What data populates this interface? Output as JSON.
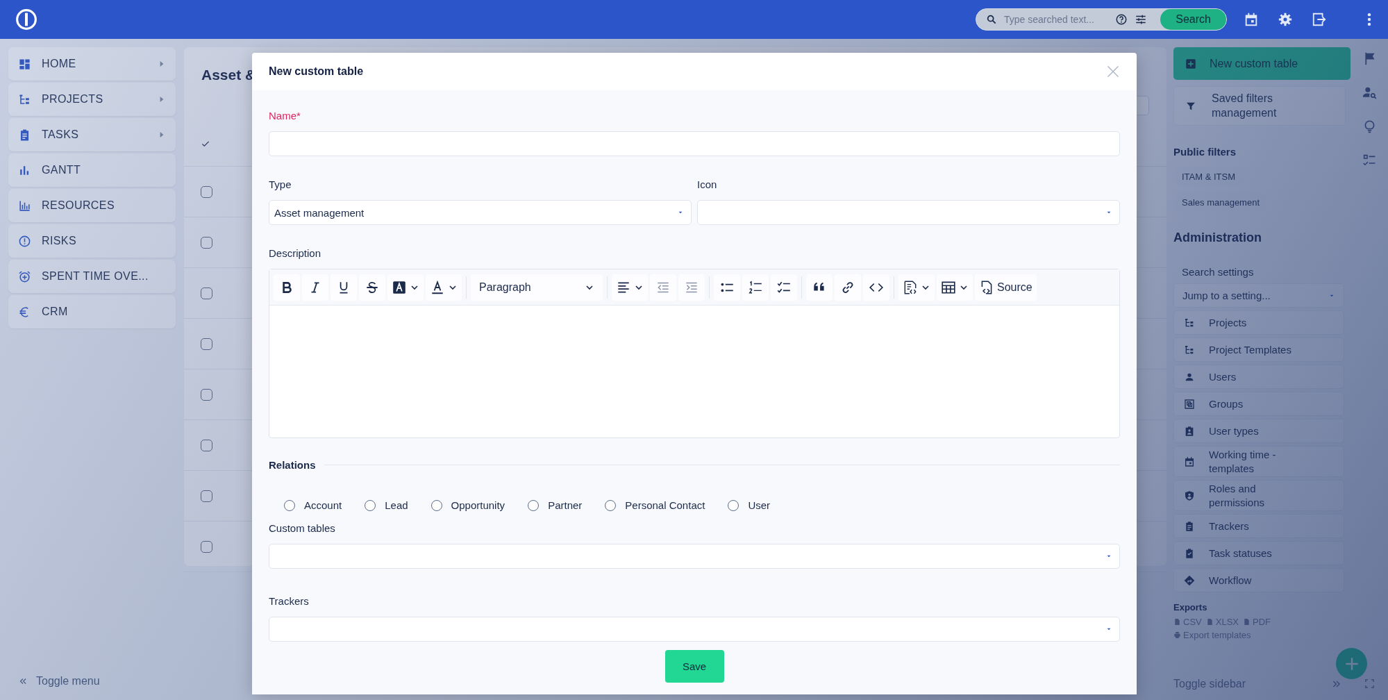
{
  "topbar": {
    "search": {
      "placeholder": "Type searched text...",
      "button": "Search"
    }
  },
  "menu": {
    "items": [
      {
        "label": "HOME",
        "has_submenu": true
      },
      {
        "label": "PROJECTS",
        "has_submenu": true
      },
      {
        "label": "TASKS",
        "has_submenu": true
      },
      {
        "label": "GANTT",
        "has_submenu": false
      },
      {
        "label": "RESOURCES",
        "has_submenu": false
      },
      {
        "label": "RISKS",
        "has_submenu": false
      },
      {
        "label": "SPENT TIME OVE...",
        "has_submenu": false
      },
      {
        "label": "CRM",
        "has_submenu": false
      }
    ],
    "toggle": "Toggle menu"
  },
  "page": {
    "title": "Asset &",
    "rows": [
      {
        "checked": false
      },
      {
        "checked": false
      },
      {
        "checked": false
      },
      {
        "checked": false
      },
      {
        "checked": false
      },
      {
        "checked": false
      },
      {
        "checked": false
      },
      {
        "checked": false
      }
    ]
  },
  "modal": {
    "title": "New custom table",
    "name": {
      "label": "Name*",
      "required": true
    },
    "type": {
      "label": "Type",
      "value": "Asset management"
    },
    "icon": {
      "label": "Icon"
    },
    "description": {
      "label": "Description",
      "toolbar": [
        [
          {
            "kind": "bold",
            "disabled": false
          },
          {
            "kind": "italic",
            "disabled": false
          },
          {
            "kind": "underline",
            "disabled": false
          },
          {
            "kind": "strike",
            "disabled": false
          },
          {
            "kind": "highlight",
            "disabled": false
          },
          {
            "kind": "font-color",
            "disabled": false
          }
        ],
        [
          {
            "kind": "heading",
            "label": "Paragraph",
            "disabled": false
          }
        ],
        [
          {
            "kind": "align",
            "disabled": false
          },
          {
            "kind": "outdent",
            "disabled": true
          },
          {
            "kind": "indent",
            "disabled": true
          }
        ],
        [
          {
            "kind": "bullets",
            "disabled": false
          },
          {
            "kind": "numbers",
            "disabled": false
          },
          {
            "kind": "todo",
            "disabled": false
          }
        ],
        [
          {
            "kind": "quote",
            "disabled": false
          },
          {
            "kind": "link",
            "disabled": false
          },
          {
            "kind": "code",
            "disabled": false
          }
        ],
        [
          {
            "kind": "code-block",
            "disabled": false
          },
          {
            "kind": "table",
            "disabled": false
          },
          {
            "kind": "source",
            "label": "Source",
            "disabled": false
          }
        ]
      ]
    },
    "relations": {
      "title": "Relations",
      "options": [
        {
          "label": "Account",
          "checked": false
        },
        {
          "label": "Lead",
          "checked": false
        },
        {
          "label": "Opportunity",
          "checked": false
        },
        {
          "label": "Partner",
          "checked": false
        },
        {
          "label": "Personal Contact",
          "checked": false
        },
        {
          "label": "User",
          "checked": false
        }
      ]
    },
    "custom_tables": {
      "label": "Custom tables"
    },
    "trackers": {
      "label": "Trackers"
    },
    "save": "Save"
  },
  "sidebar": {
    "new_button": "New custom table",
    "saved_filters": "Saved filters management",
    "public_filters": {
      "title": "Public filters",
      "items": [
        "ITAM & ITSM",
        "Sales management"
      ]
    },
    "administration": {
      "title": "Administration",
      "search_label": "Search settings",
      "jump_placeholder": "Jump to a setting...",
      "items": [
        "Projects",
        "Project Templates",
        "Users",
        "Groups",
        "User types",
        "Working time - templates",
        "Roles and permissions",
        "Trackers",
        "Task statuses",
        "Workflow"
      ]
    },
    "exports": {
      "title": "Exports",
      "formats": [
        "CSV",
        "XLSX",
        "PDF"
      ],
      "templates": "Export templates"
    },
    "toggle": "Toggle sidebar"
  }
}
